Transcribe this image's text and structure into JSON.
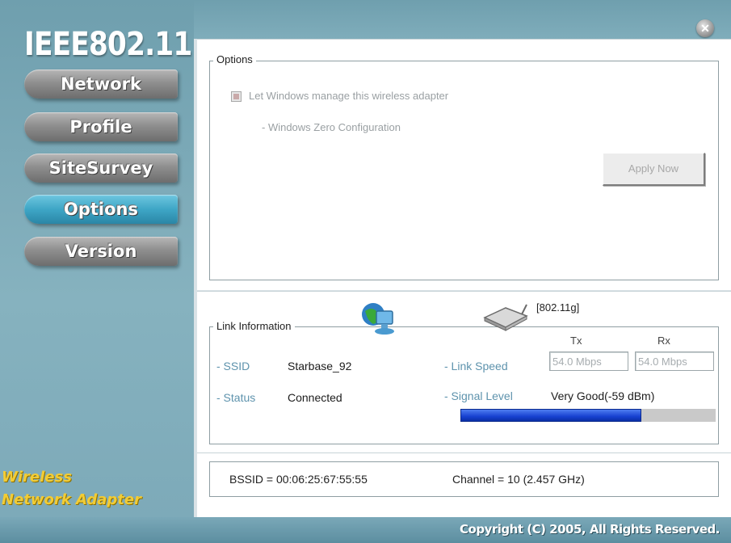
{
  "app": {
    "brand": "IEEE802.11",
    "tagline_line1": "Wireless",
    "tagline_line2": "Network Adapter",
    "copyright": "Copyright (C) 2005, All Rights Reserved."
  },
  "sidebar": {
    "items": [
      {
        "label": "Network",
        "active": false
      },
      {
        "label": "Profile",
        "active": false
      },
      {
        "label": "SiteSurvey",
        "active": false
      },
      {
        "label": "Options",
        "active": true
      },
      {
        "label": "Version",
        "active": false
      }
    ]
  },
  "options": {
    "title": "Options",
    "checkbox_label": "Let Windows manage this wireless adapter",
    "zero_config": "- Windows Zero Configuration",
    "apply_label": "Apply Now"
  },
  "link": {
    "title": "Link Information",
    "mode": "[802.11g]",
    "ssid_label": "- SSID",
    "ssid_value": "Starbase_92",
    "status_label": "- Status",
    "status_value": "Connected",
    "tx_label": "Tx",
    "rx_label": "Rx",
    "speed_label": "- Link Speed",
    "tx_value": "54.0 Mbps",
    "rx_value": "54.0 Mbps",
    "signal_label": "- Signal Level",
    "signal_value": "Very Good(-59 dBm)",
    "signal_fraction": 0.71
  },
  "footer": {
    "bssid": "BSSID = 00:06:25:67:55:55",
    "channel": "Channel = 10 (2.457 GHz)"
  },
  "colors": {
    "accent": "#3ea6c6",
    "signal": "#1741d1",
    "tagline": "#f2cc35"
  }
}
